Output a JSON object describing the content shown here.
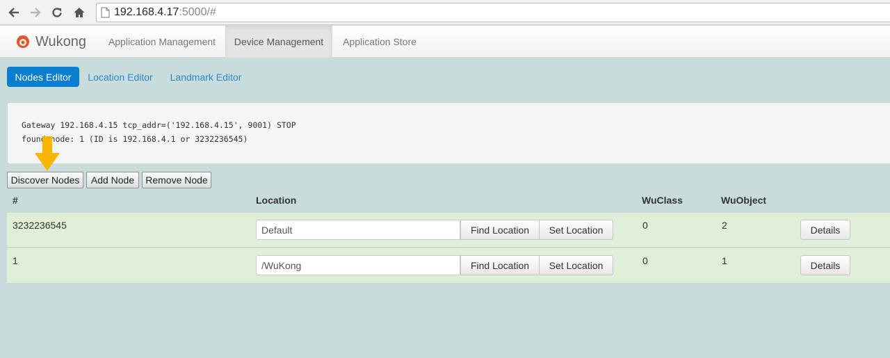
{
  "browser": {
    "url_host": "192.168.4.17",
    "url_rest": ":5000/#"
  },
  "navbar": {
    "brand": "Wukong",
    "items": [
      {
        "label": "Application Management"
      },
      {
        "label": "Device Management",
        "active": true
      },
      {
        "label": "Application Store"
      }
    ]
  },
  "tabs": [
    {
      "label": "Nodes Editor",
      "active": true
    },
    {
      "label": "Location Editor"
    },
    {
      "label": "Landmark Editor"
    }
  ],
  "console": {
    "lines": [
      "Gateway 192.168.4.15 tcp_addr=('192.168.4.15', 9001) STOP",
      "found node: 1 (ID is 192.168.4.1 or 3232236545)"
    ]
  },
  "actions": {
    "discover": "Discover Nodes",
    "add": "Add Node",
    "remove": "Remove Node"
  },
  "table": {
    "headers": {
      "id": "#",
      "location": "Location",
      "wuclass": "WuClass",
      "wuobject": "WuObject"
    },
    "rows": [
      {
        "id": "3232236545",
        "location": "Default",
        "wuclass": "0",
        "wuobject": "2"
      },
      {
        "id": "1",
        "location": "/WuKong",
        "wuclass": "0",
        "wuobject": "1"
      }
    ],
    "find_label": "Find Location",
    "set_label": "Set Location",
    "details_label": "Details"
  },
  "colors": {
    "background": "#c9dcdc",
    "accent": "#0a7fcf",
    "row": "#dfefd8",
    "arrow": "#f7b500",
    "brand_icon": "#e8542a"
  }
}
